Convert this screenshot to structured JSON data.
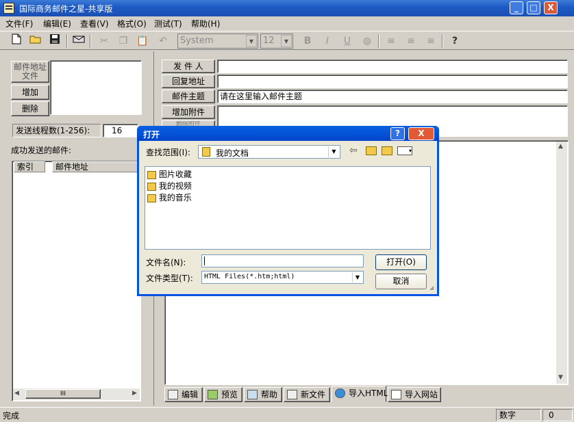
{
  "window": {
    "title": "国际商务邮件之星-共享版",
    "controls": {
      "minimize": "_",
      "maximize": "□",
      "close": "X"
    }
  },
  "menu": [
    {
      "label": "文件(F)"
    },
    {
      "label": "编辑(E)"
    },
    {
      "label": "查看(V)"
    },
    {
      "label": "格式(O)"
    },
    {
      "label": "测试(T)"
    },
    {
      "label": "帮助(H)"
    }
  ],
  "toolbar": {
    "font_value": "System",
    "size_value": "12",
    "bold": "B",
    "italic": "I",
    "underline": "U",
    "help": "?"
  },
  "left": {
    "address_file_button": "邮件地址文件",
    "add_button": "增加",
    "delete_button": "删除",
    "thread_label": "发送线程数(1-256):",
    "thread_value": "16",
    "sent_label": "成功发送的邮件:",
    "columns": [
      "索引",
      "邮件地址"
    ],
    "scroll_thumb": "III"
  },
  "form": {
    "sender_label": "发 件 人",
    "sender_value": "",
    "reply_label": "回复地址",
    "reply_value": "",
    "subject_label": "邮件主题",
    "subject_value": "请在这里输入邮件主题",
    "add_attach_label": "增加附件",
    "del_attach_label": "删除附件"
  },
  "tabs": [
    {
      "label": "编辑"
    },
    {
      "label": "预览"
    },
    {
      "label": "帮助"
    },
    {
      "label": "新文件"
    },
    {
      "label": "导入HTML"
    },
    {
      "label": "导入网站"
    }
  ],
  "status": {
    "text": "完成",
    "mode": "数字",
    "count": "0"
  },
  "dialog": {
    "title": "打开",
    "look_in_label": "查找范围(I):",
    "look_in_value": "我的文档",
    "files": [
      {
        "name": "图片收藏"
      },
      {
        "name": "我的视频"
      },
      {
        "name": "我的音乐"
      }
    ],
    "filename_label": "文件名(N):",
    "filename_value": "",
    "filetype_label": "文件类型(T):",
    "filetype_value": "HTML Files(*.htm;html)",
    "open_button": "打开(O)",
    "cancel_button": "取消",
    "help_cap": "?",
    "close_cap": "X"
  }
}
